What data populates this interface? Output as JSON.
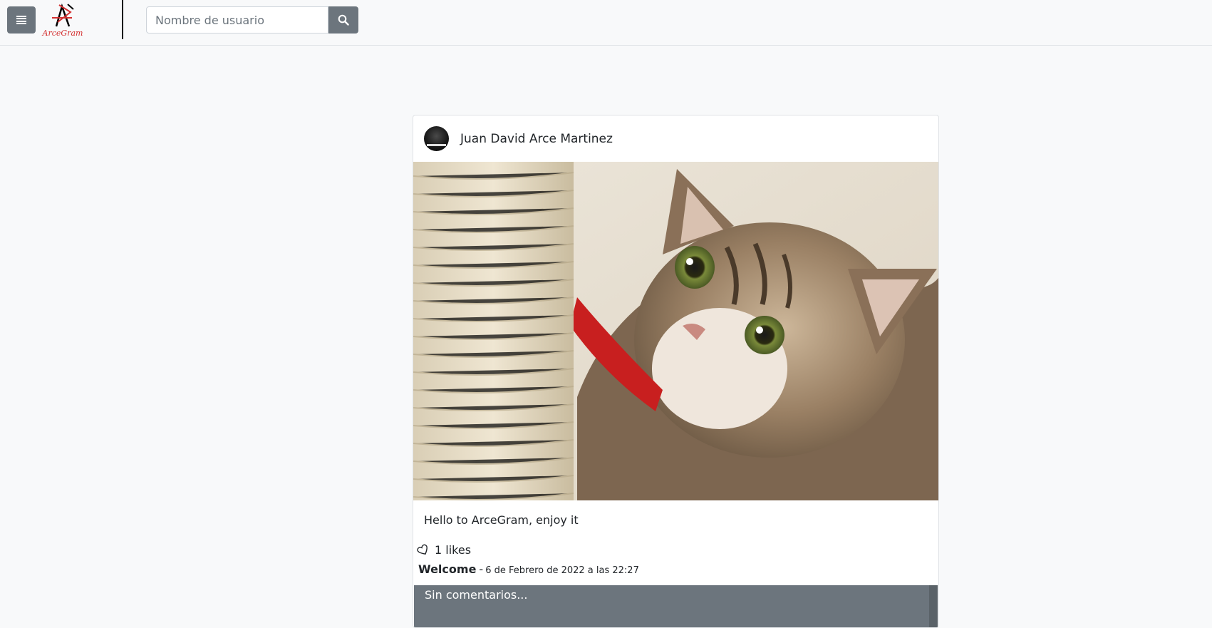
{
  "app": {
    "brand": "ArceGram"
  },
  "navbar": {
    "search_placeholder": "Nombre de usuario",
    "brand_color": "#d32f2f"
  },
  "post": {
    "author": "Juan David Arce Martinez",
    "caption": "Hello to ArceGram, enjoy it",
    "likes": "1 likes",
    "title": "Welcome",
    "separator": "-",
    "date": "6 de Febrero de 2022 a las 22:27",
    "comments_placeholder": "Sin comentarios..."
  },
  "icons": {
    "menu": "hamburger-icon",
    "search": "search-icon",
    "like": "heart-outline-icon"
  }
}
